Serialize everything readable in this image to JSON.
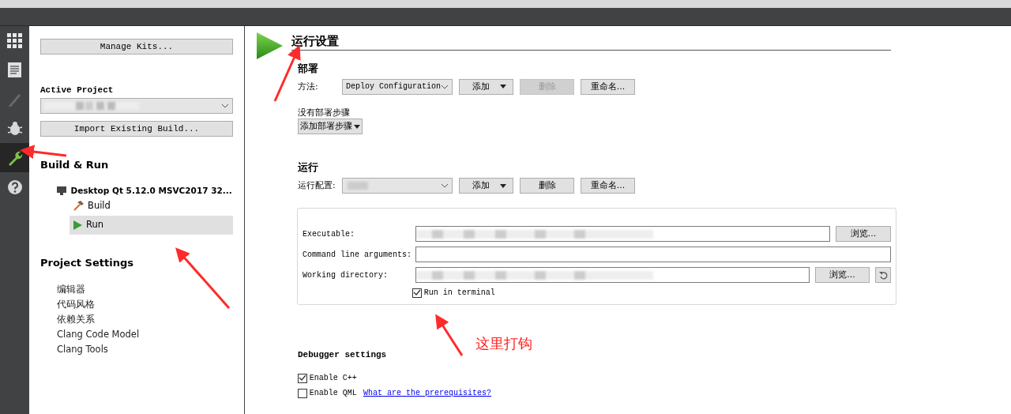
{
  "activity_bar": [
    {
      "kind": "grid",
      "selected": false
    },
    {
      "kind": "document",
      "selected": false
    },
    {
      "kind": "pencil",
      "selected": false
    },
    {
      "kind": "bug",
      "selected": false
    },
    {
      "kind": "wrench",
      "selected": true
    },
    {
      "kind": "help",
      "selected": false
    }
  ],
  "sidebar": {
    "manage_kits": "Manage Kits...",
    "active_project_label": "Active Project",
    "import_button": "Import Existing Build...",
    "build_run_heading": "Build & Run",
    "kit": "Desktop Qt 5.12.0 MSVC2017 32...",
    "kit_items": [
      {
        "label": "Build",
        "kind": "build",
        "selected": false
      },
      {
        "label": "Run",
        "kind": "run",
        "selected": true
      }
    ],
    "project_settings_heading": "Project Settings",
    "settings_items": [
      "编辑器",
      "代码风格",
      "依赖关系",
      "Clang Code Model",
      "Clang Tools"
    ]
  },
  "main": {
    "title": "运行设置",
    "deploy": {
      "heading": "部署",
      "method_label": "方法:",
      "method_value": "Deploy Configuration",
      "buttons": [
        {
          "label": "添加",
          "dropdown": true,
          "disabled": false
        },
        {
          "label": "删除",
          "dropdown": false,
          "disabled": true
        },
        {
          "label": "重命名...",
          "dropdown": false,
          "disabled": false
        }
      ],
      "no_steps": "没有部署步骤",
      "add_step": "添加部署步骤"
    },
    "run": {
      "heading": "运行",
      "config_label": "运行配置:",
      "buttons": [
        {
          "label": "添加",
          "dropdown": true,
          "disabled": false
        },
        {
          "label": "删除",
          "dropdown": false,
          "disabled": false
        },
        {
          "label": "重命名...",
          "dropdown": false,
          "disabled": false
        }
      ],
      "rows": [
        {
          "label": "Executable:",
          "browse": "浏览...",
          "reset": false
        },
        {
          "label": "Command line arguments:",
          "reset": false
        },
        {
          "label": "Working directory:",
          "browse": "浏览...",
          "reset": true
        }
      ],
      "run_in_terminal": {
        "label": "Run in terminal",
        "checked": true
      }
    },
    "debugger": {
      "heading": "Debugger settings",
      "options": [
        {
          "label": "Enable C++",
          "checked": true
        },
        {
          "label": "Enable QML",
          "checked": false,
          "link": "What are the prerequisites?"
        }
      ]
    }
  },
  "annotation": {
    "note": "这里打钩"
  }
}
